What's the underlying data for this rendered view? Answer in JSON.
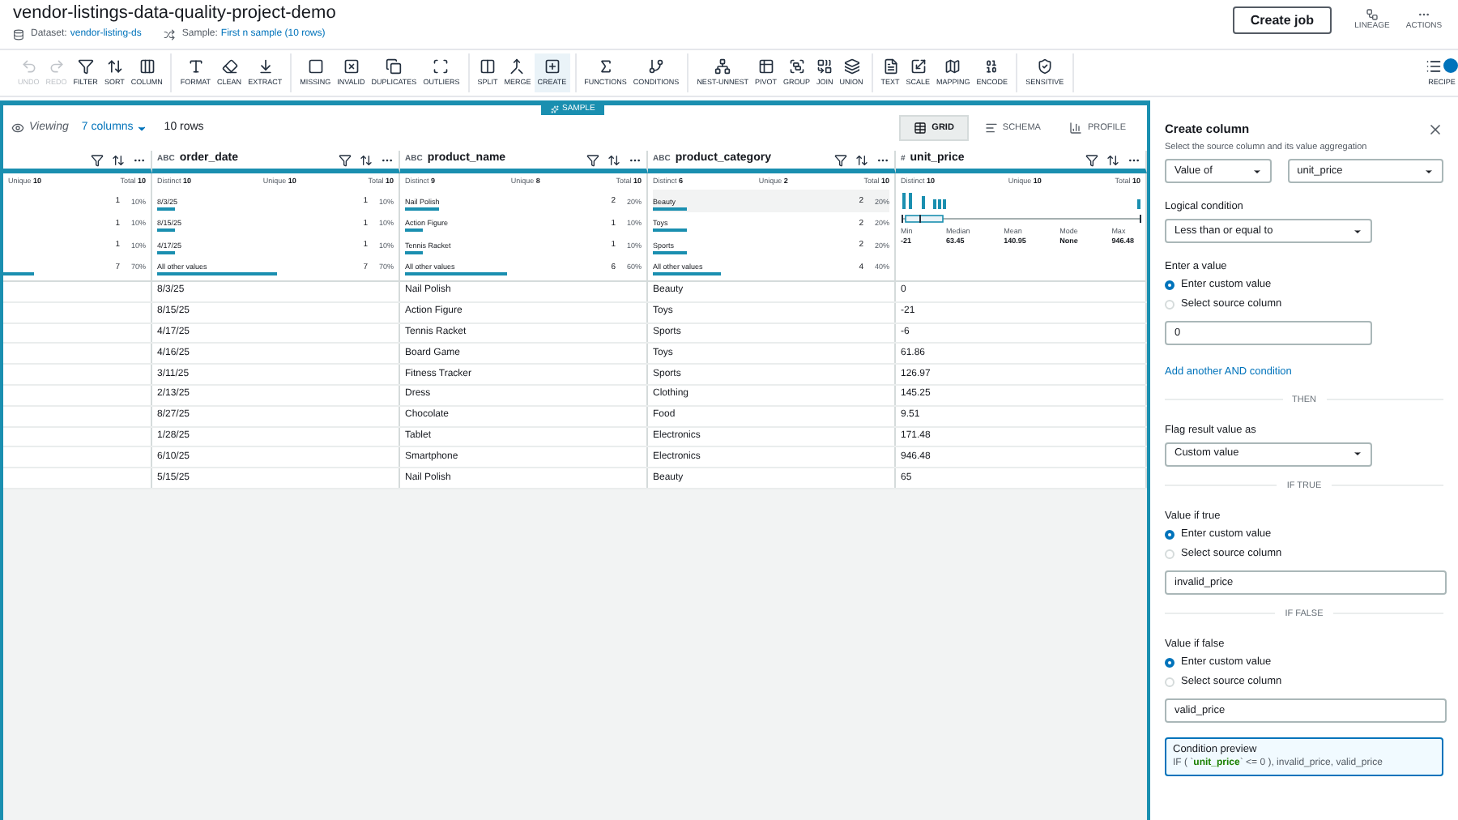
{
  "header": {
    "title": "vendor-listings-data-quality-project-demo",
    "dataset_label": "Dataset:",
    "dataset": "vendor-listing-ds",
    "sample_label": "Sample:",
    "sample": "First n sample (10 rows)",
    "create_job": "Create job",
    "actions": [
      {
        "label": "LINEAGE"
      },
      {
        "label": "ACTIONS"
      }
    ]
  },
  "toolbar": {
    "groups": [
      [
        {
          "label": "UNDO",
          "disabled": true,
          "selected": false
        },
        {
          "label": "REDO",
          "disabled": true,
          "selected": false
        },
        {
          "label": "FILTER",
          "disabled": false,
          "selected": false
        },
        {
          "label": "SORT",
          "disabled": false,
          "selected": false
        },
        {
          "label": "COLUMN",
          "disabled": false,
          "selected": false
        }
      ],
      [
        {
          "label": "FORMAT",
          "disabled": false,
          "selected": false
        },
        {
          "label": "CLEAN",
          "disabled": false,
          "selected": false
        },
        {
          "label": "EXTRACT",
          "disabled": false,
          "selected": false
        }
      ],
      [
        {
          "label": "MISSING",
          "disabled": false,
          "selected": false
        },
        {
          "label": "INVALID",
          "disabled": false,
          "selected": false
        },
        {
          "label": "DUPLICATES",
          "disabled": false,
          "selected": false
        },
        {
          "label": "OUTLIERS",
          "disabled": false,
          "selected": false
        }
      ],
      [
        {
          "label": "SPLIT",
          "disabled": false,
          "selected": false
        },
        {
          "label": "MERGE",
          "disabled": false,
          "selected": false
        },
        {
          "label": "CREATE",
          "disabled": false,
          "selected": true
        }
      ],
      [
        {
          "label": "FUNCTIONS",
          "disabled": false,
          "selected": false
        },
        {
          "label": "CONDITIONS",
          "disabled": false,
          "selected": false
        }
      ],
      [
        {
          "label": "NEST-UNNEST",
          "disabled": false,
          "selected": false
        },
        {
          "label": "PIVOT",
          "disabled": false,
          "selected": false
        },
        {
          "label": "GROUP",
          "disabled": false,
          "selected": false
        },
        {
          "label": "JOIN",
          "disabled": false,
          "selected": false
        },
        {
          "label": "UNION",
          "disabled": false,
          "selected": false
        }
      ],
      [
        {
          "label": "TEXT",
          "disabled": false,
          "selected": false
        },
        {
          "label": "SCALE",
          "disabled": false,
          "selected": false
        },
        {
          "label": "MAPPING",
          "disabled": false,
          "selected": false
        },
        {
          "label": "ENCODE",
          "disabled": false,
          "selected": false
        }
      ],
      [
        {
          "label": "SENSITIVE",
          "disabled": false,
          "selected": false
        }
      ]
    ],
    "recipe": "RECIPE"
  },
  "grid": {
    "sample_tag": "SAMPLE",
    "viewing": {
      "label": "Viewing",
      "columns": "7 columns",
      "rows": "10 rows"
    },
    "views": [
      {
        "label": "GRID",
        "selected": true
      },
      {
        "label": "SCHEMA",
        "selected": false
      },
      {
        "label": "PROFILE",
        "selected": false
      }
    ],
    "columns": [
      {
        "kind": "partial",
        "stats": [
          {
            "label": "Unique",
            "value": "10"
          },
          {
            "label": "Total",
            "value": "10"
          }
        ],
        "top_values": [
          {
            "count": "1",
            "pct": "10%"
          },
          {
            "count": "1",
            "pct": "10%"
          },
          {
            "count": "1",
            "pct": "10%"
          },
          {
            "count": "7",
            "pct": "70%"
          }
        ]
      },
      {
        "kind": "text",
        "type": "ABC",
        "name": "order_date",
        "stats": [
          {
            "label": "Distinct",
            "value": "10"
          },
          {
            "label": "Unique",
            "value": "10"
          },
          {
            "label": "Total",
            "value": "10"
          }
        ],
        "top_values": [
          {
            "label": "8/3/25",
            "count": "1",
            "pct": "10%"
          },
          {
            "label": "8/15/25",
            "count": "1",
            "pct": "10%"
          },
          {
            "label": "4/17/25",
            "count": "1",
            "pct": "10%"
          },
          {
            "label": "All other values",
            "count": "7",
            "pct": "70%"
          }
        ]
      },
      {
        "kind": "text",
        "type": "ABC",
        "name": "product_name",
        "stats": [
          {
            "label": "Distinct",
            "value": "9"
          },
          {
            "label": "Unique",
            "value": "8"
          },
          {
            "label": "Total",
            "value": "10"
          }
        ],
        "top_values": [
          {
            "label": "Nail Polish",
            "count": "2",
            "pct": "20%"
          },
          {
            "label": "Action Figure",
            "count": "1",
            "pct": "10%"
          },
          {
            "label": "Tennis Racket",
            "count": "1",
            "pct": "10%"
          },
          {
            "label": "All other values",
            "count": "6",
            "pct": "60%"
          }
        ]
      },
      {
        "kind": "text",
        "type": "ABC",
        "name": "product_category",
        "stats": [
          {
            "label": "Distinct",
            "value": "6"
          },
          {
            "label": "Unique",
            "value": "2"
          },
          {
            "label": "Total",
            "value": "10"
          }
        ],
        "top_values": [
          {
            "label": "Beauty",
            "count": "2",
            "pct": "20%"
          },
          {
            "label": "Toys",
            "count": "2",
            "pct": "20%"
          },
          {
            "label": "Sports",
            "count": "2",
            "pct": "20%"
          },
          {
            "label": "All other values",
            "count": "4",
            "pct": "40%"
          }
        ]
      },
      {
        "kind": "numeric",
        "type": "#",
        "name": "unit_price",
        "stats": [
          {
            "label": "Distinct",
            "value": "10"
          },
          {
            "label": "Unique",
            "value": "10"
          },
          {
            "label": "Total",
            "value": "10"
          }
        ],
        "summary": [
          {
            "label": "Min",
            "value": "-21"
          },
          {
            "label": "Median",
            "value": "63.45"
          },
          {
            "label": "Mean",
            "value": "140.95"
          },
          {
            "label": "Mode",
            "value": "None"
          },
          {
            "label": "Max",
            "value": "946.48"
          }
        ]
      }
    ],
    "rows": [
      [
        "",
        "8/3/25",
        "Nail Polish",
        "Beauty",
        "0"
      ],
      [
        "",
        "8/15/25",
        "Action Figure",
        "Toys",
        "-21"
      ],
      [
        "",
        "4/17/25",
        "Tennis Racket",
        "Sports",
        "-6"
      ],
      [
        "",
        "4/16/25",
        "Board Game",
        "Toys",
        "61.86"
      ],
      [
        "",
        "3/11/25",
        "Fitness Tracker",
        "Sports",
        "126.97"
      ],
      [
        "",
        "2/13/25",
        "Dress",
        "Clothing",
        "145.25"
      ],
      [
        "",
        "8/27/25",
        "Chocolate",
        "Food",
        "9.51"
      ],
      [
        "",
        "1/28/25",
        "Tablet",
        "Electronics",
        "171.48"
      ],
      [
        "",
        "6/10/25",
        "Smartphone",
        "Electronics",
        "946.48"
      ],
      [
        "",
        "5/15/25",
        "Nail Polish",
        "Beauty",
        "65"
      ]
    ]
  },
  "panel": {
    "title": "Create column",
    "items": [
      {
        "kind": "hint",
        "text": "Select the source column and its value aggregation"
      },
      {
        "kind": "selects",
        "values": [
          "Value of",
          "unit_price"
        ]
      },
      {
        "kind": "label",
        "text": "Logical condition"
      },
      {
        "kind": "select",
        "value": "Less than or equal to"
      },
      {
        "kind": "label",
        "text": "Enter a value"
      },
      {
        "kind": "radios",
        "options": [
          {
            "label": "Enter custom value",
            "selected": true
          },
          {
            "label": "Select source column",
            "selected": false
          }
        ]
      },
      {
        "kind": "input",
        "value": "0"
      },
      {
        "kind": "link",
        "text": "Add another AND condition"
      },
      {
        "kind": "divider",
        "text": "THEN"
      },
      {
        "kind": "label",
        "text": "Flag result value as"
      },
      {
        "kind": "select",
        "value": "Custom value"
      },
      {
        "kind": "divider",
        "text": "IF TRUE"
      },
      {
        "kind": "label",
        "text": "Value if true"
      },
      {
        "kind": "radios",
        "options": [
          {
            "label": "Enter custom value",
            "selected": true
          },
          {
            "label": "Select source column",
            "selected": false
          }
        ]
      },
      {
        "kind": "input",
        "value": "invalid_price",
        "wide": true
      },
      {
        "kind": "divider",
        "text": "IF FALSE"
      },
      {
        "kind": "label",
        "text": "Value if false"
      },
      {
        "kind": "radios",
        "options": [
          {
            "label": "Enter custom value",
            "selected": true
          },
          {
            "label": "Select source column",
            "selected": false
          }
        ]
      },
      {
        "kind": "input",
        "value": "valid_price",
        "wide": true
      },
      {
        "kind": "preview",
        "title": "Condition preview",
        "prefix": "IF ( `",
        "column": "unit_price",
        "suffix": "` <= 0 ), invalid_price, valid_price"
      }
    ]
  }
}
